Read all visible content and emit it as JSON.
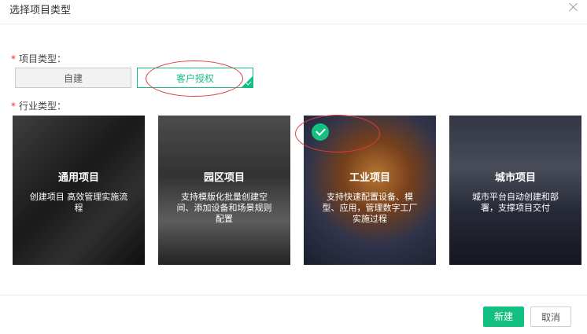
{
  "dialog": {
    "title": "选择项目类型"
  },
  "project_type": {
    "label": "项目类型：",
    "options": [
      {
        "label": "自建",
        "selected": false
      },
      {
        "label": "客户授权",
        "selected": true
      }
    ]
  },
  "industry_type": {
    "label": "行业类型：",
    "cards": [
      {
        "title": "通用项目",
        "desc": "创建项目 高效管理实施流程",
        "selected": false
      },
      {
        "title": "园区项目",
        "desc": "支持模版化批量创建空间、添加设备和场景规则配置",
        "selected": false
      },
      {
        "title": "工业项目",
        "desc": "支持快速配置设备、模型、应用，管理数字工厂实施过程",
        "selected": true
      },
      {
        "title": "城市项目",
        "desc": "城市平台自动创建和部署，支撑项目交付",
        "selected": false
      }
    ]
  },
  "footer": {
    "create_label": "新建",
    "cancel_label": "取消"
  },
  "colors": {
    "accent": "#15bf81",
    "required": "#f5222d",
    "annotation": "#e23a3a"
  }
}
